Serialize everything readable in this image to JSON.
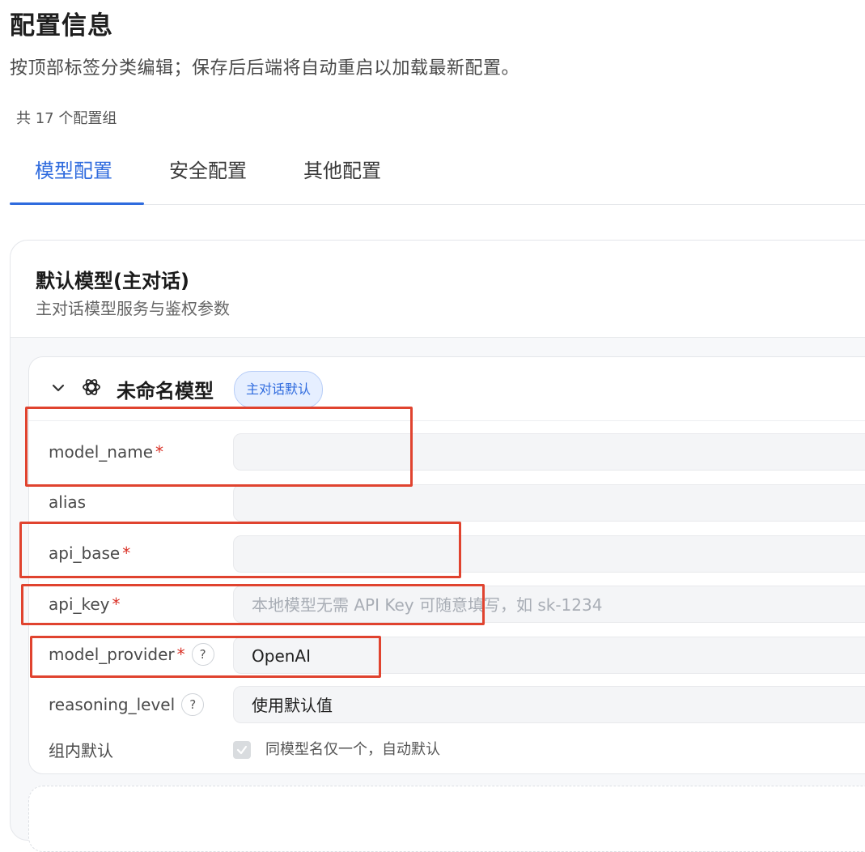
{
  "page": {
    "title": "配置信息",
    "description": "按顶部标签分类编辑；保存后后端将自动重启以加载最新配置。",
    "group_count": "共 17 个配置组"
  },
  "tabs": [
    {
      "label": "模型配置",
      "active": true
    },
    {
      "label": "安全配置",
      "active": false
    },
    {
      "label": "其他配置",
      "active": false
    }
  ],
  "section": {
    "title": "默认模型(主对话)",
    "subtitle": "主对话模型服务与鉴权参数"
  },
  "model": {
    "name": "未命名模型",
    "badge": "主对话默认",
    "icon": "openai-icon",
    "fields": [
      {
        "label": "model_name",
        "required": true,
        "value": "",
        "placeholder": ""
      },
      {
        "label": "alias",
        "required": false,
        "value": "",
        "placeholder": ""
      },
      {
        "label": "api_base",
        "required": true,
        "value": "",
        "placeholder": ""
      },
      {
        "label": "api_key",
        "required": true,
        "value": "",
        "placeholder": "本地模型无需 API Key 可随意填写，如 sk-1234"
      },
      {
        "label": "model_provider",
        "required": true,
        "help": "?",
        "value": "OpenAI"
      },
      {
        "label": "reasoning_level",
        "required": false,
        "help": "?",
        "value": "使用默认值"
      }
    ],
    "group_default": {
      "label": "组内默认",
      "checkbox_label": "同模型名仅一个，自动默认",
      "checked": true
    }
  },
  "colors": {
    "accent": "#2f6bde",
    "required": "#d93025",
    "highlight": "#e0432f"
  }
}
